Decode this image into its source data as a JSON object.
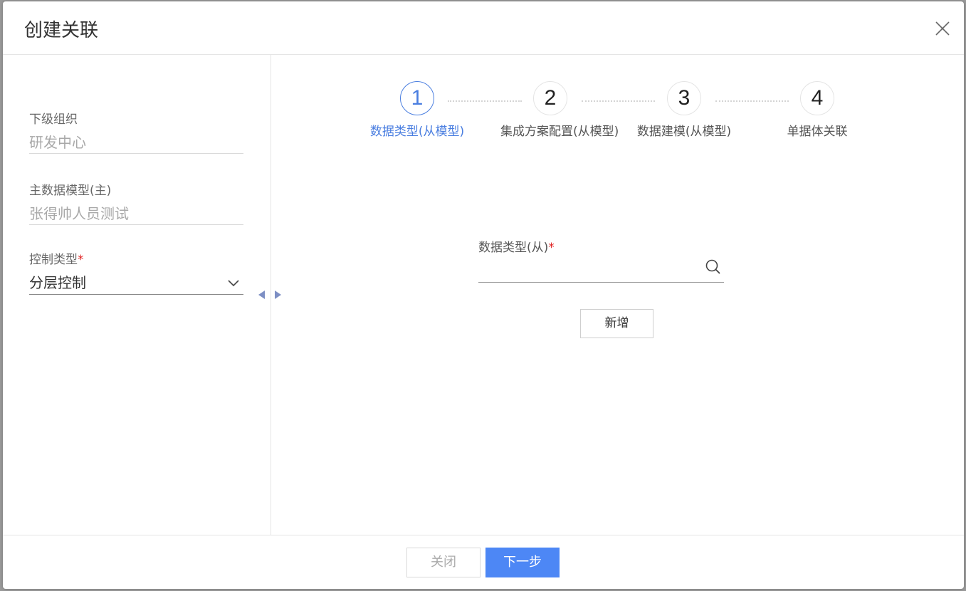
{
  "dialog": {
    "title": "创建关联",
    "close_icon": "close-icon"
  },
  "left": {
    "fields": [
      {
        "label": "下级组织",
        "value": "研发中心"
      },
      {
        "label": "主数据模型(主)",
        "value": "张得帅人员测试"
      }
    ],
    "control_type": {
      "label": "控制类型",
      "required_mark": "*",
      "value": "分层控制",
      "icon": "chevron-down-icon"
    }
  },
  "steps": [
    {
      "number": "1",
      "label": "数据类型(从模型)",
      "active": true
    },
    {
      "number": "2",
      "label": "集成方案配置(从模型)",
      "active": false
    },
    {
      "number": "3",
      "label": "数据建模(从模型)",
      "active": false
    },
    {
      "number": "4",
      "label": "单据体关联",
      "active": false
    }
  ],
  "form": {
    "data_type_label": "数据类型(从)",
    "required_mark": "*",
    "data_type_value": "",
    "search_icon": "search-icon",
    "add_button": "新增"
  },
  "footer": {
    "close_button": "关闭",
    "next_button": "下一步"
  },
  "colors": {
    "accent": "#4a7ee0",
    "primary_button": "#4d87f5",
    "required": "#e02020"
  }
}
